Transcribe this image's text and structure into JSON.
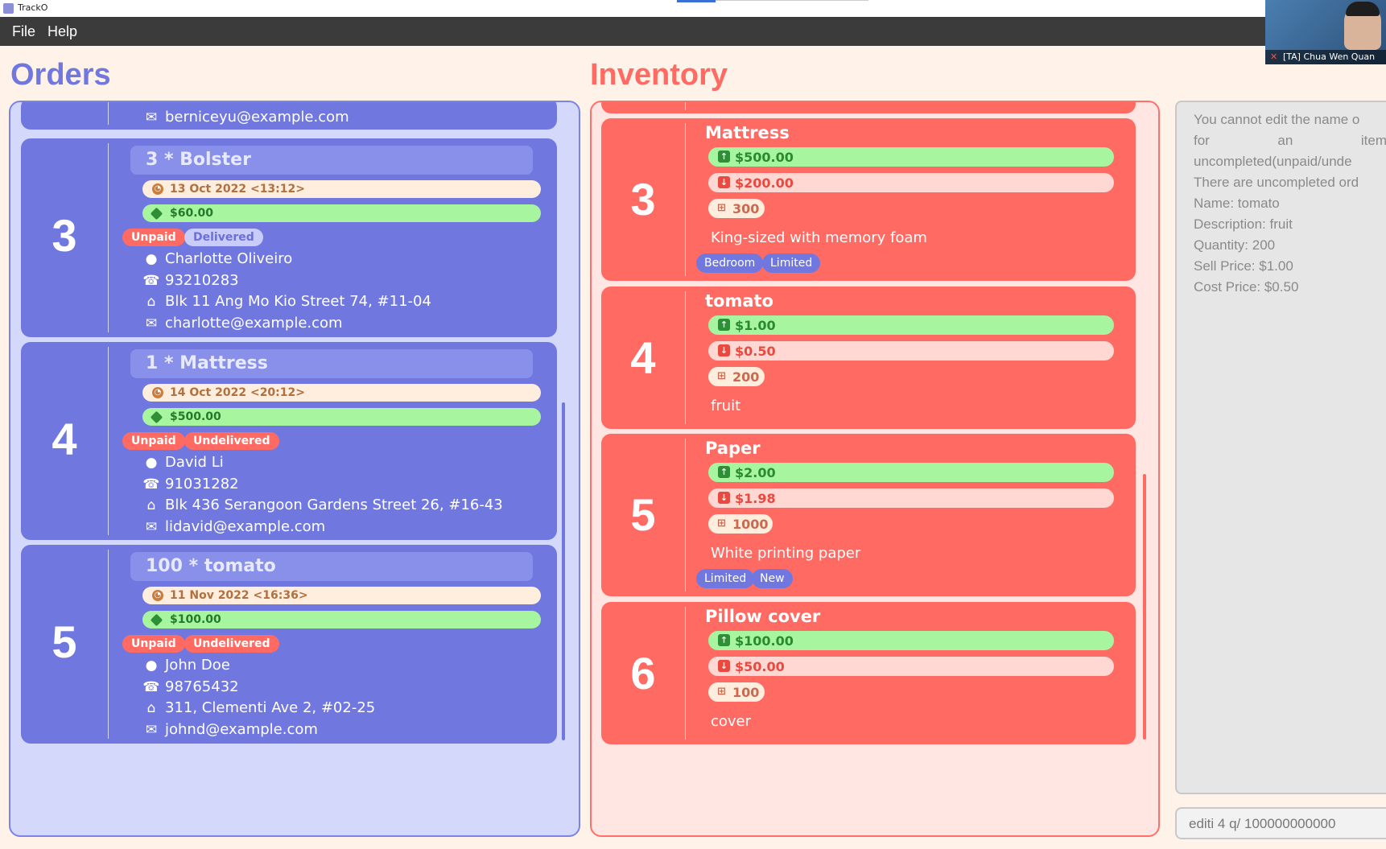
{
  "window": {
    "title": "TrackO"
  },
  "menu": {
    "file": "File",
    "help": "Help"
  },
  "video": {
    "caption": "[TA] Chua Wen Quan"
  },
  "orders": {
    "heading": "Orders",
    "partial_email": "berniceyu@example.com",
    "cards": [
      {
        "index": "3",
        "title": "3 * Bolster",
        "date": "13 Oct 2022 <13:12>",
        "price": "$60.00",
        "payment": "Unpaid",
        "delivery": "Delivered",
        "name": "Charlotte Oliveiro",
        "phone": "93210283",
        "address": "Blk 11 Ang Mo Kio Street 74, #11-04",
        "email": "charlotte@example.com"
      },
      {
        "index": "4",
        "title": "1 * Mattress",
        "date": "14 Oct 2022 <20:12>",
        "price": "$500.00",
        "payment": "Unpaid",
        "delivery": "Undelivered",
        "name": "David Li",
        "phone": "91031282",
        "address": "Blk 436 Serangoon Gardens Street 26, #16-43",
        "email": "lidavid@example.com"
      },
      {
        "index": "5",
        "title": "100 * tomato",
        "date": "11 Nov 2022 <16:36>",
        "price": "$100.00",
        "payment": "Unpaid",
        "delivery": "Undelivered",
        "name": "John Doe",
        "phone": "98765432",
        "address": "311, Clementi Ave 2, #02-25",
        "email": "johnd@example.com"
      }
    ]
  },
  "inventory": {
    "heading": "Inventory",
    "cards": [
      {
        "index": "3",
        "name": "Mattress",
        "sell": "$500.00",
        "cost": "$200.00",
        "qty": "300",
        "desc": "King-sized with memory foam",
        "tags": [
          "Bedroom",
          "Limited"
        ]
      },
      {
        "index": "4",
        "name": "tomato",
        "sell": "$1.00",
        "cost": "$0.50",
        "qty": "200",
        "desc": "fruit",
        "tags": []
      },
      {
        "index": "5",
        "name": "Paper",
        "sell": "$2.00",
        "cost": "$1.98",
        "qty": "1000",
        "desc": "White printing paper",
        "tags": [
          "Limited",
          "New"
        ]
      },
      {
        "index": "6",
        "name": "Pillow cover",
        "sell": "$100.00",
        "cost": "$50.00",
        "qty": "100",
        "desc": "cover",
        "tags": []
      }
    ]
  },
  "result": {
    "line1": "You cannot edit the name o",
    "line2_words": [
      "for",
      "an",
      "item"
    ],
    "line3": "uncompleted(unpaid/unde",
    "line4": "There are uncompleted ord",
    "line5": "Name: tomato",
    "line6": "Description: fruit",
    "line7": "Quantity: 200",
    "line8": "Sell Price: $1.00",
    "line9": "Cost Price: $0.50"
  },
  "command": {
    "value": "editi 4 q/ 100000000000"
  },
  "colors": {
    "orders": "#7078e0",
    "inventory": "#ff6b63",
    "background": "#fff2e8"
  },
  "icons": {
    "date": "clock-icon",
    "price": "tag-icon",
    "name": "person-icon",
    "phone": "phone-icon",
    "address": "home-icon",
    "email": "email-icon",
    "sell": "sell-arrow-icon",
    "cost": "cost-arrow-icon",
    "qty": "cart-icon"
  }
}
